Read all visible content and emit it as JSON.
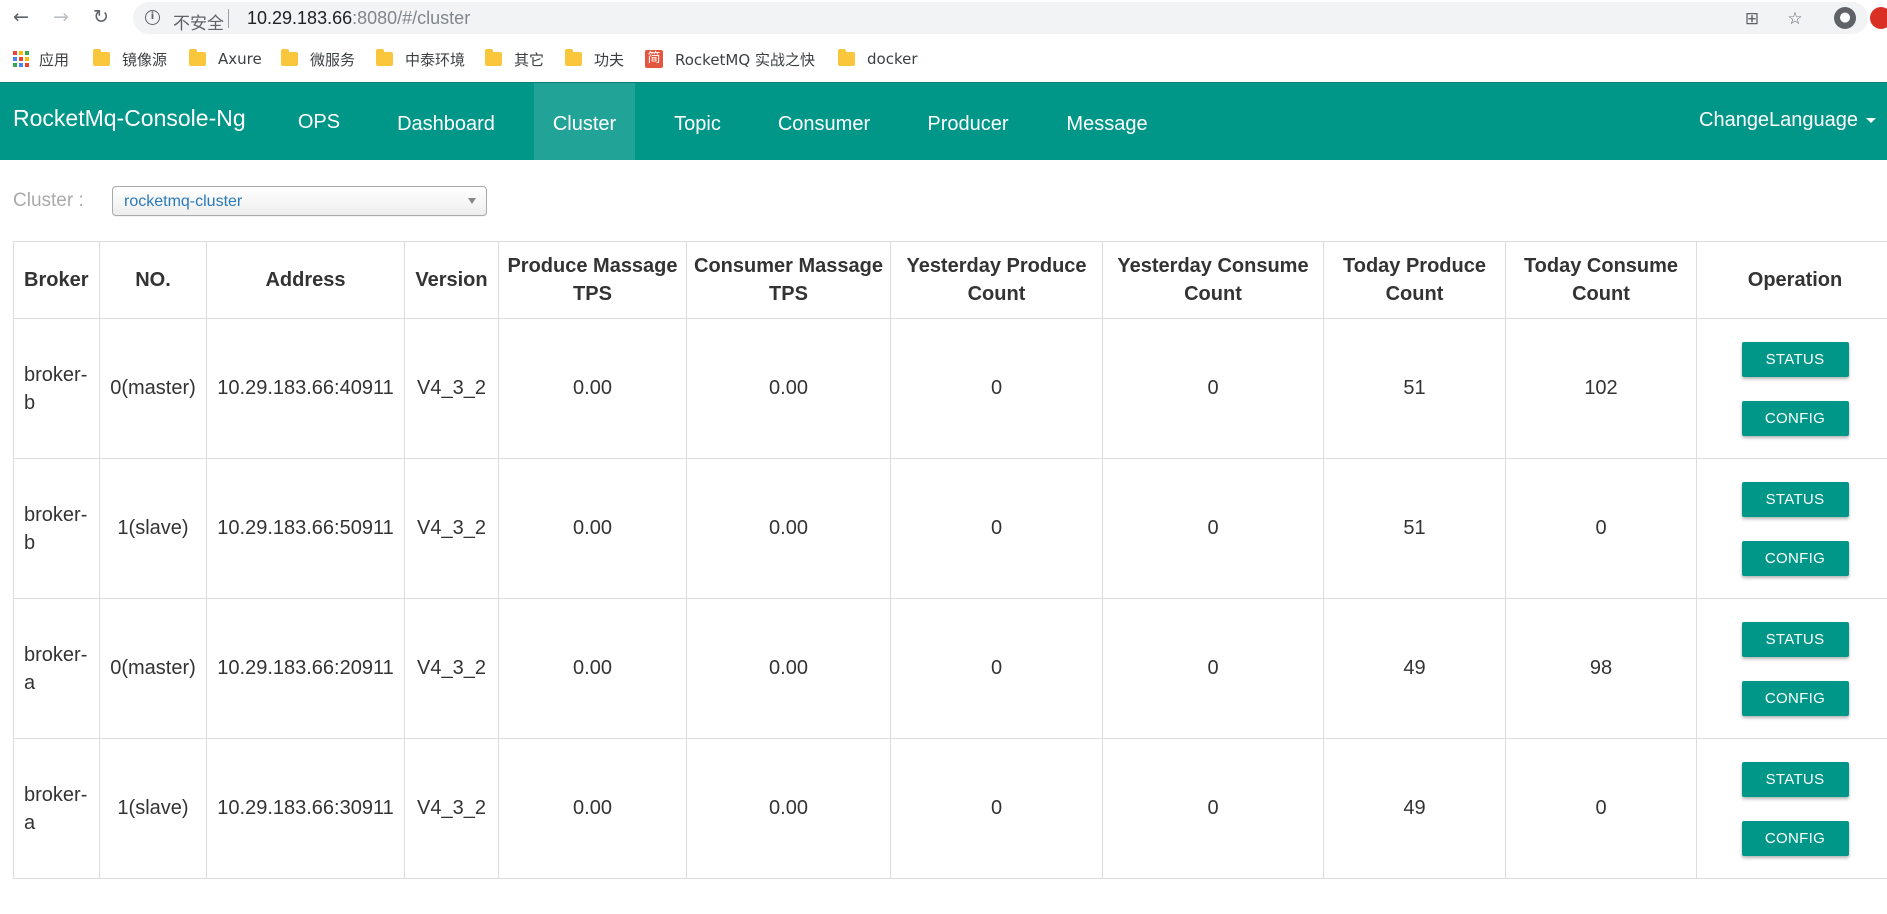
{
  "browser": {
    "back": "←",
    "forward": "→",
    "reload": "↻",
    "security_label": "不安全",
    "url_host": "10.29.183.66",
    "url_rest": ":8080/#/cluster",
    "translate_icon": "translate-icon",
    "star_icon": "star-icon",
    "profile_icon": "profile-icon"
  },
  "bookmarks": [
    {
      "label": "应用",
      "icon": "apps"
    },
    {
      "label": "镜像源",
      "icon": "folder"
    },
    {
      "label": "Axure",
      "icon": "folder"
    },
    {
      "label": "微服务",
      "icon": "folder"
    },
    {
      "label": "中泰环境",
      "icon": "folder"
    },
    {
      "label": "其它",
      "icon": "folder"
    },
    {
      "label": "功夫",
      "icon": "folder"
    },
    {
      "label": "RocketMQ 实战之快",
      "icon": "jian"
    },
    {
      "label": "docker",
      "icon": "folder"
    }
  ],
  "navbar": {
    "brand": "RocketMq-Console-Ng",
    "items": [
      "OPS",
      "Dashboard",
      "Cluster",
      "Topic",
      "Consumer",
      "Producer",
      "Message"
    ],
    "active": "Cluster",
    "language": "ChangeLanguage",
    "accent": "#009688"
  },
  "cluster": {
    "label": "Cluster :",
    "selected": "rocketmq-cluster"
  },
  "table": {
    "headers": {
      "broker": "Broker",
      "no": "NO.",
      "address": "Address",
      "version": "Version",
      "produce_tps": "Produce Massage TPS",
      "consumer_tps": "Consumer Massage TPS",
      "yesterday_produce": "Yesterday Produce Count",
      "yesterday_consume": "Yesterday Consume Count",
      "today_produce": "Today Produce Count",
      "today_consume": "Today Consume Count",
      "operation": "Operation"
    },
    "rows": [
      {
        "broker": "broker-b",
        "no": "0(master)",
        "address": "10.29.183.66:40911",
        "version": "V4_3_2",
        "produce_tps": "0.00",
        "consumer_tps": "0.00",
        "yesterday_produce": "0",
        "yesterday_consume": "0",
        "today_produce": "51",
        "today_consume": "102",
        "status_label": "STATUS",
        "config_label": "CONFIG"
      },
      {
        "broker": "broker-b",
        "no": "1(slave)",
        "address": "10.29.183.66:50911",
        "version": "V4_3_2",
        "produce_tps": "0.00",
        "consumer_tps": "0.00",
        "yesterday_produce": "0",
        "yesterday_consume": "0",
        "today_produce": "51",
        "today_consume": "0",
        "status_label": "STATUS",
        "config_label": "CONFIG"
      },
      {
        "broker": "broker-a",
        "no": "0(master)",
        "address": "10.29.183.66:20911",
        "version": "V4_3_2",
        "produce_tps": "0.00",
        "consumer_tps": "0.00",
        "yesterday_produce": "0",
        "yesterday_consume": "0",
        "today_produce": "49",
        "today_consume": "98",
        "status_label": "STATUS",
        "config_label": "CONFIG"
      },
      {
        "broker": "broker-a",
        "no": "1(slave)",
        "address": "10.29.183.66:30911",
        "version": "V4_3_2",
        "produce_tps": "0.00",
        "consumer_tps": "0.00",
        "yesterday_produce": "0",
        "yesterday_consume": "0",
        "today_produce": "49",
        "today_consume": "0",
        "status_label": "STATUS",
        "config_label": "CONFIG"
      }
    ]
  }
}
